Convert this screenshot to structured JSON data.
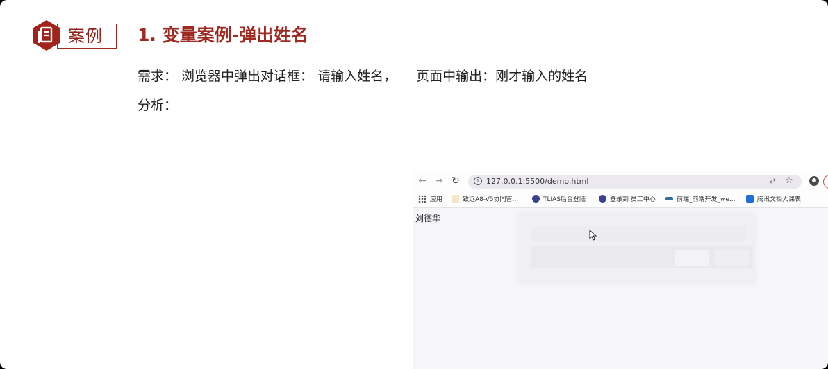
{
  "slide": {
    "badge_label": "案例",
    "title": "1. 变量案例-弹出姓名",
    "requirement_part1": "需求： 浏览器中弹出对话框： 请输入姓名，",
    "requirement_part2": "页面中输出：刚才输入的姓名",
    "analysis_label": "分析："
  },
  "browser": {
    "url": "127.0.0.1:5500/demo.html",
    "bookmarks": [
      {
        "label": "应用",
        "icon": "apps-grid-icon"
      },
      {
        "label": "致远A8-V5协同管...",
        "icon": "a8-logo-icon"
      },
      {
        "label": "TLIAS后台登陆",
        "icon": "tlias-logo-icon"
      },
      {
        "label": "登录到 员工中心",
        "icon": "staff-center-icon"
      },
      {
        "label": "前端_前端开发_we...",
        "icon": "frontend-icon"
      },
      {
        "label": "腾讯文档大课表",
        "icon": "tencent-docs-icon"
      }
    ],
    "page_output": "刘德华"
  },
  "colors": {
    "brand_red": "#9e2a22"
  }
}
